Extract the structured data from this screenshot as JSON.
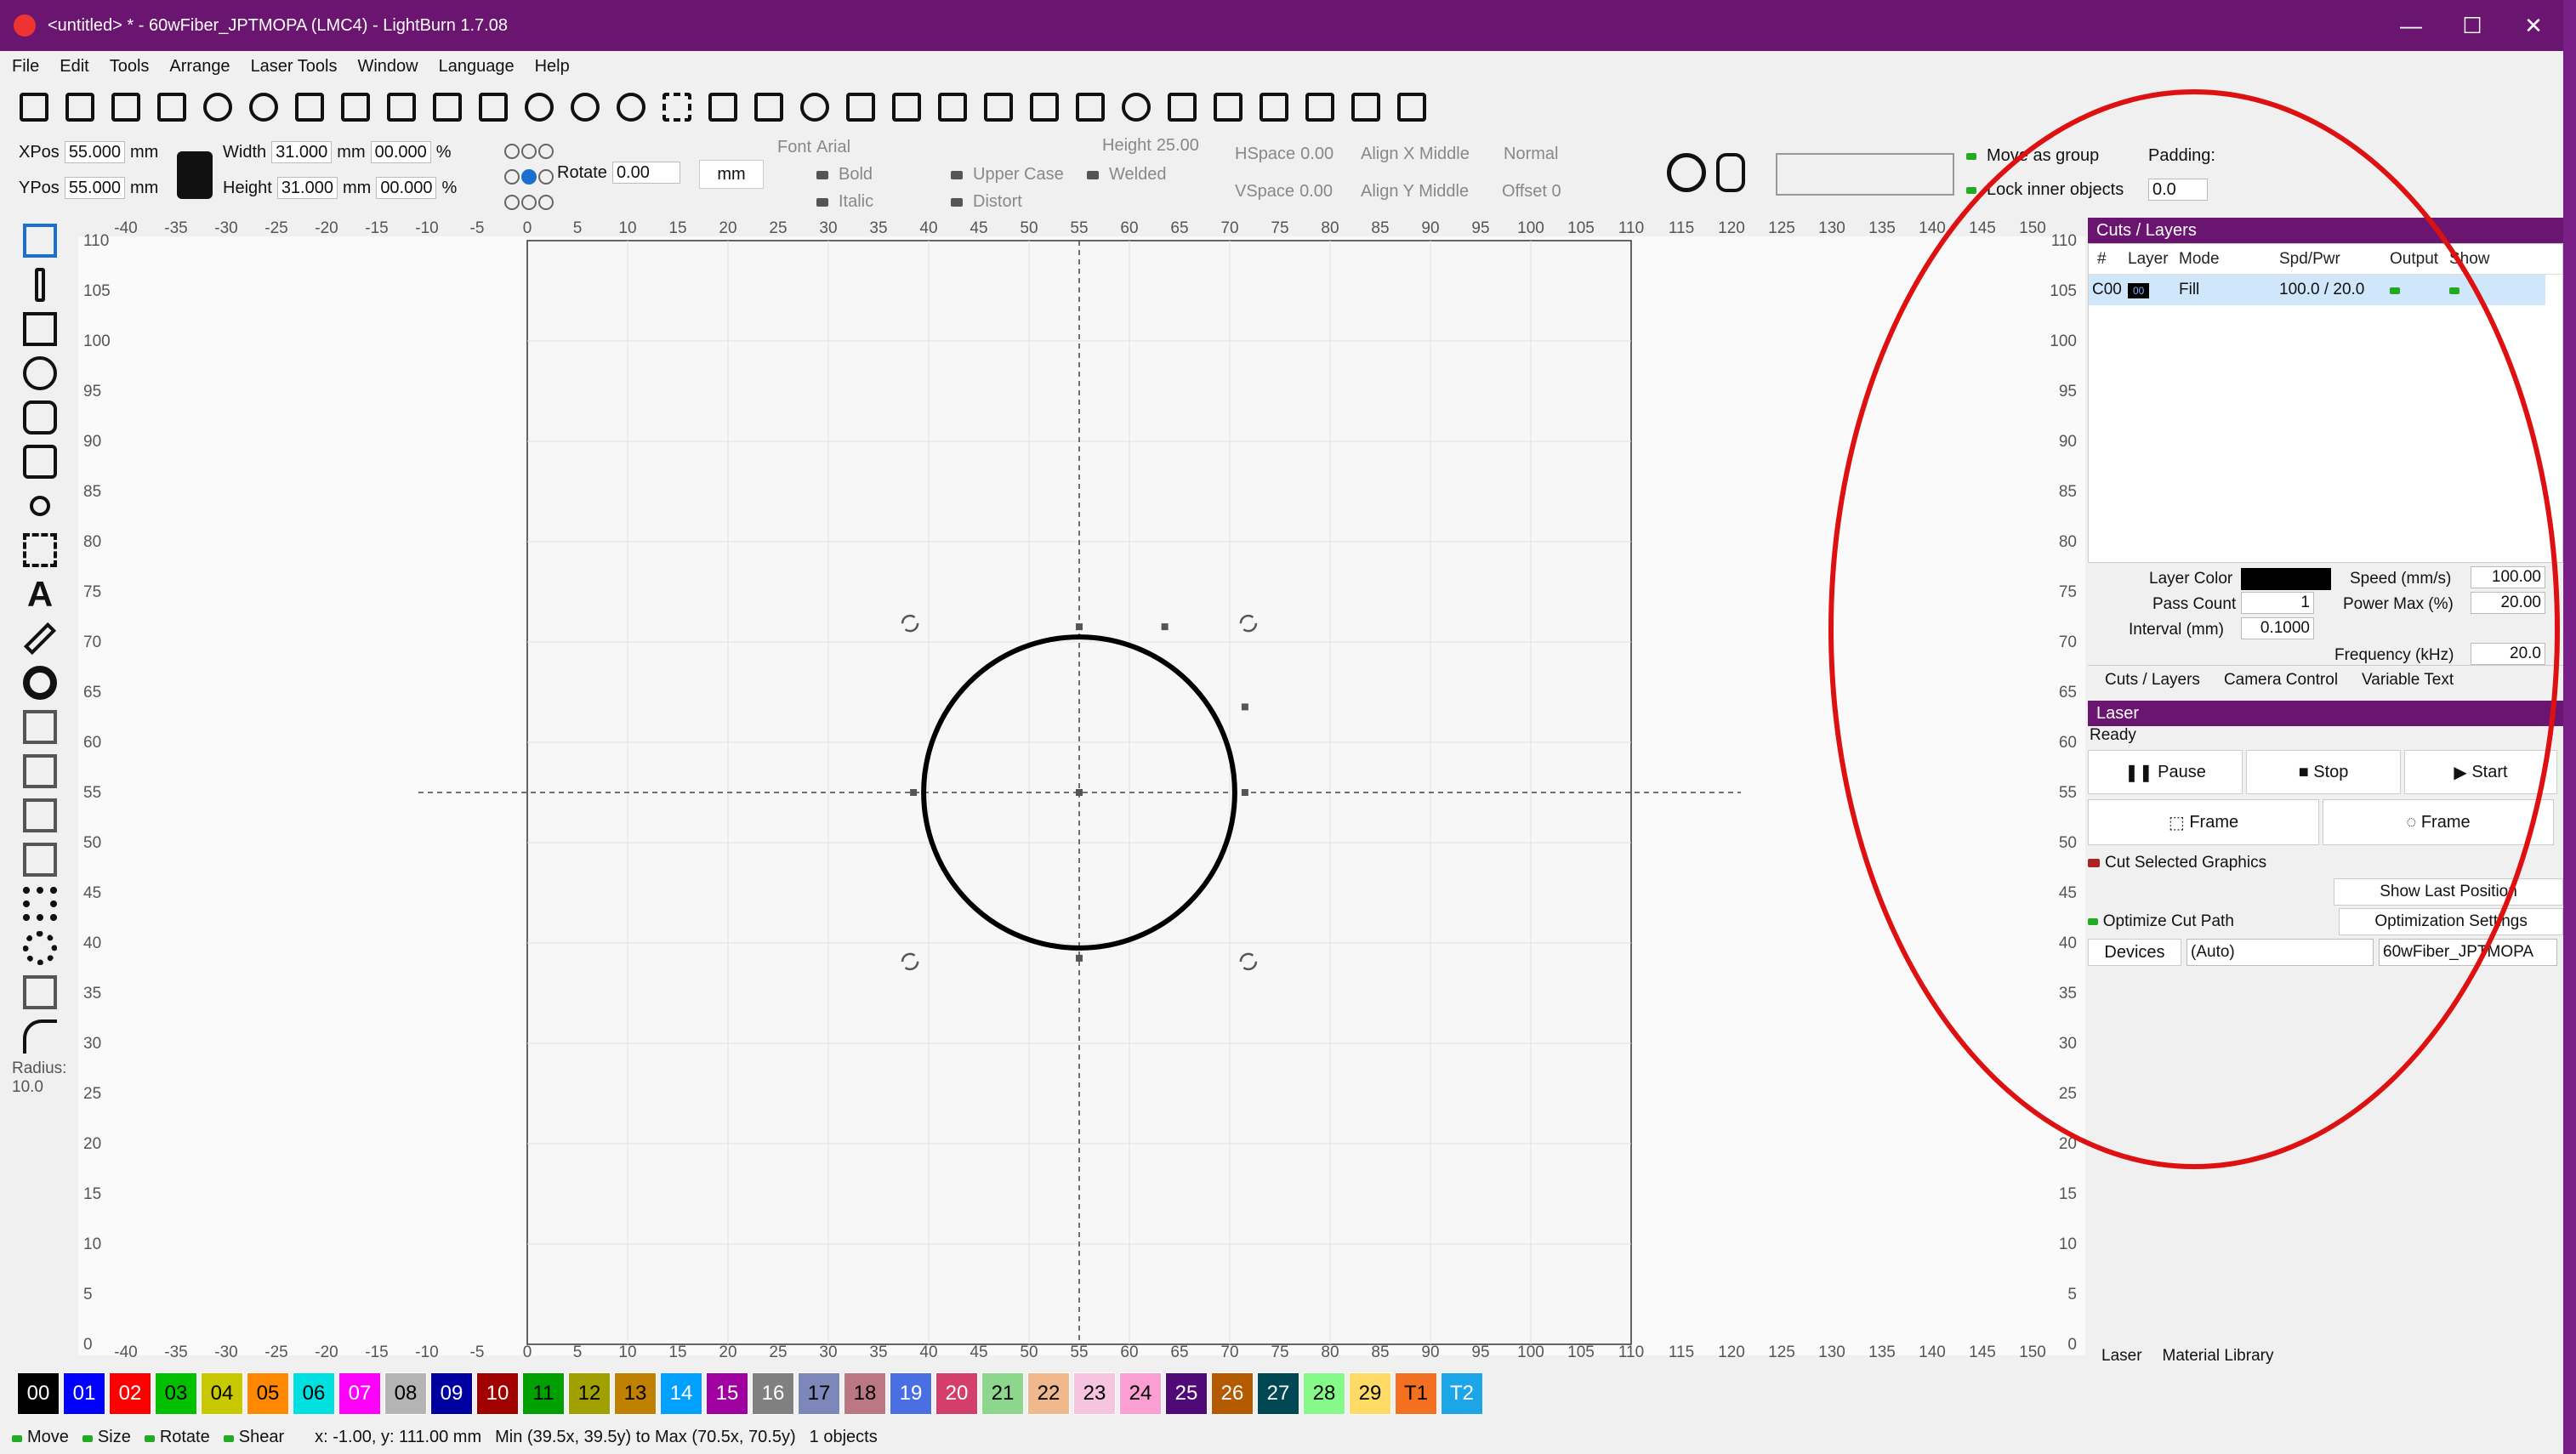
{
  "window": {
    "title": "<untitled> * - 60wFiber_JPTMOPA (LMC4) - LightBurn 1.7.08",
    "min": "—",
    "max": "☐",
    "close": "✕"
  },
  "menu": [
    "File",
    "Edit",
    "Tools",
    "Arrange",
    "Laser Tools",
    "Window",
    "Language",
    "Help"
  ],
  "props": {
    "xpos_label": "XPos",
    "xpos": "55.000",
    "ypos_label": "YPos",
    "ypos": "55.000",
    "unit": "mm",
    "width_label": "Width",
    "width": "31.000",
    "height_label": "Height",
    "height": "31.000",
    "pct1": "00.000",
    "pct2": "00.000",
    "pct": "%",
    "rotate_label": "Rotate",
    "rotate": "0.00",
    "units_btn": "mm",
    "font_label": "Font",
    "font": "Arial",
    "font_height_label": "Height",
    "font_height": "25.00",
    "bold": "Bold",
    "italic": "Italic",
    "upper": "Upper Case",
    "distort": "Distort",
    "welded": "Welded",
    "hspace_label": "HSpace",
    "hspace": "0.00",
    "vspace_label": "VSpace",
    "vspace": "0.00",
    "alignx": "Align X Middle",
    "aligny": "Align Y Middle",
    "normal": "Normal",
    "offset": "Offset 0",
    "move_group": "Move as group",
    "lock_inner": "Lock inner objects",
    "padding_label": "Padding:",
    "padding": "0.0"
  },
  "ruler": {
    "x_ticks": [
      "-40",
      "-35",
      "-30",
      "-25",
      "-20",
      "-15",
      "-10",
      "-5",
      "0",
      "5",
      "10",
      "15",
      "20",
      "25",
      "30",
      "35",
      "40",
      "45",
      "50",
      "55",
      "60",
      "65",
      "70",
      "75",
      "80",
      "85",
      "90",
      "95",
      "100",
      "105",
      "110",
      "115",
      "120",
      "125",
      "130",
      "135",
      "140",
      "145",
      "150"
    ],
    "y_ticks": [
      "110",
      "105",
      "100",
      "95",
      "90",
      "85",
      "80",
      "75",
      "70",
      "65",
      "60",
      "55",
      "50",
      "45",
      "40",
      "35",
      "30",
      "25",
      "20",
      "15",
      "10",
      "5",
      "0"
    ]
  },
  "cuts": {
    "title": "Cuts / Layers",
    "headers": [
      "#",
      "Layer",
      "Mode",
      "Spd/Pwr",
      "Output",
      "Show"
    ],
    "row": {
      "num": "C00",
      "layer": "00",
      "mode": "Fill",
      "spdpwr": "100.0 / 20.0"
    },
    "layer_color_label": "Layer Color",
    "speed_label": "Speed (mm/s)",
    "speed": "100.00",
    "pass_label": "Pass Count",
    "pass": "1",
    "power_label": "Power Max (%)",
    "power": "20.00",
    "interval_label": "Interval (mm)",
    "interval": "0.1000",
    "freq_label": "Frequency (kHz)",
    "freq": "20.0",
    "tabs": [
      "Cuts / Layers",
      "Camera Control",
      "Variable Text"
    ]
  },
  "laser": {
    "title": "Laser",
    "status": "Ready",
    "pause": "Pause",
    "stop": "Stop",
    "start": "Start",
    "frame1": "Frame",
    "frame2": "Frame",
    "cut_selected": "Cut Selected Graphics",
    "show_last": "Show Last Position",
    "optimize": "Optimize Cut Path",
    "opt_settings": "Optimization Settings",
    "devices": "Devices",
    "auto": "(Auto)",
    "device": "60wFiber_JPTMOPA",
    "tabs": [
      "Laser",
      "Material Library"
    ]
  },
  "palette": [
    {
      "l": "00",
      "c": "#000000",
      "t": "#ffffff"
    },
    {
      "l": "01",
      "c": "#0000ff",
      "t": "#ffffff"
    },
    {
      "l": "02",
      "c": "#ff0000",
      "t": "#ffffff"
    },
    {
      "l": "03",
      "c": "#00c000",
      "t": "#000000"
    },
    {
      "l": "04",
      "c": "#c8c800",
      "t": "#000000"
    },
    {
      "l": "05",
      "c": "#ff8800",
      "t": "#000000"
    },
    {
      "l": "06",
      "c": "#00e0e0",
      "t": "#000000"
    },
    {
      "l": "07",
      "c": "#ff00ff",
      "t": "#ffffff"
    },
    {
      "l": "08",
      "c": "#b4b4b4",
      "t": "#000000"
    },
    {
      "l": "09",
      "c": "#0000a0",
      "t": "#ffffff"
    },
    {
      "l": "10",
      "c": "#a00000",
      "t": "#ffffff"
    },
    {
      "l": "11",
      "c": "#00a000",
      "t": "#000000"
    },
    {
      "l": "12",
      "c": "#a0a000",
      "t": "#000000"
    },
    {
      "l": "13",
      "c": "#c08000",
      "t": "#000000"
    },
    {
      "l": "14",
      "c": "#00a0ff",
      "t": "#ffffff"
    },
    {
      "l": "15",
      "c": "#a000a0",
      "t": "#ffffff"
    },
    {
      "l": "16",
      "c": "#808080",
      "t": "#ffffff"
    },
    {
      "l": "17",
      "c": "#7d87b9",
      "t": "#000000"
    },
    {
      "l": "18",
      "c": "#bb7784",
      "t": "#000000"
    },
    {
      "l": "19",
      "c": "#4a6fe3",
      "t": "#ffffff"
    },
    {
      "l": "20",
      "c": "#d33f6a",
      "t": "#ffffff"
    },
    {
      "l": "21",
      "c": "#8cd78c",
      "t": "#000000"
    },
    {
      "l": "22",
      "c": "#f0b98d",
      "t": "#000000"
    },
    {
      "l": "23",
      "c": "#f6c4e1",
      "t": "#000000"
    },
    {
      "l": "24",
      "c": "#fa9ed4",
      "t": "#000000"
    },
    {
      "l": "25",
      "c": "#500a78",
      "t": "#ffffff"
    },
    {
      "l": "26",
      "c": "#b45a00",
      "t": "#ffffff"
    },
    {
      "l": "27",
      "c": "#004754",
      "t": "#ffffff"
    },
    {
      "l": "28",
      "c": "#86fa88",
      "t": "#000000"
    },
    {
      "l": "29",
      "c": "#ffdb66",
      "t": "#000000"
    },
    {
      "l": "T1",
      "c": "#f37021",
      "t": "#000000"
    },
    {
      "l": "T2",
      "c": "#1ca6e8",
      "t": "#ffffff"
    }
  ],
  "status": {
    "move": "Move",
    "size": "Size",
    "rotate": "Rotate",
    "shear": "Shear",
    "coords": "x: -1.00, y: 111.00 mm",
    "range": "Min (39.5x, 39.5y) to Max (70.5x, 70.5y)",
    "objects": "1 objects"
  },
  "radius": {
    "label": "Radius:",
    "value": "10.0"
  }
}
